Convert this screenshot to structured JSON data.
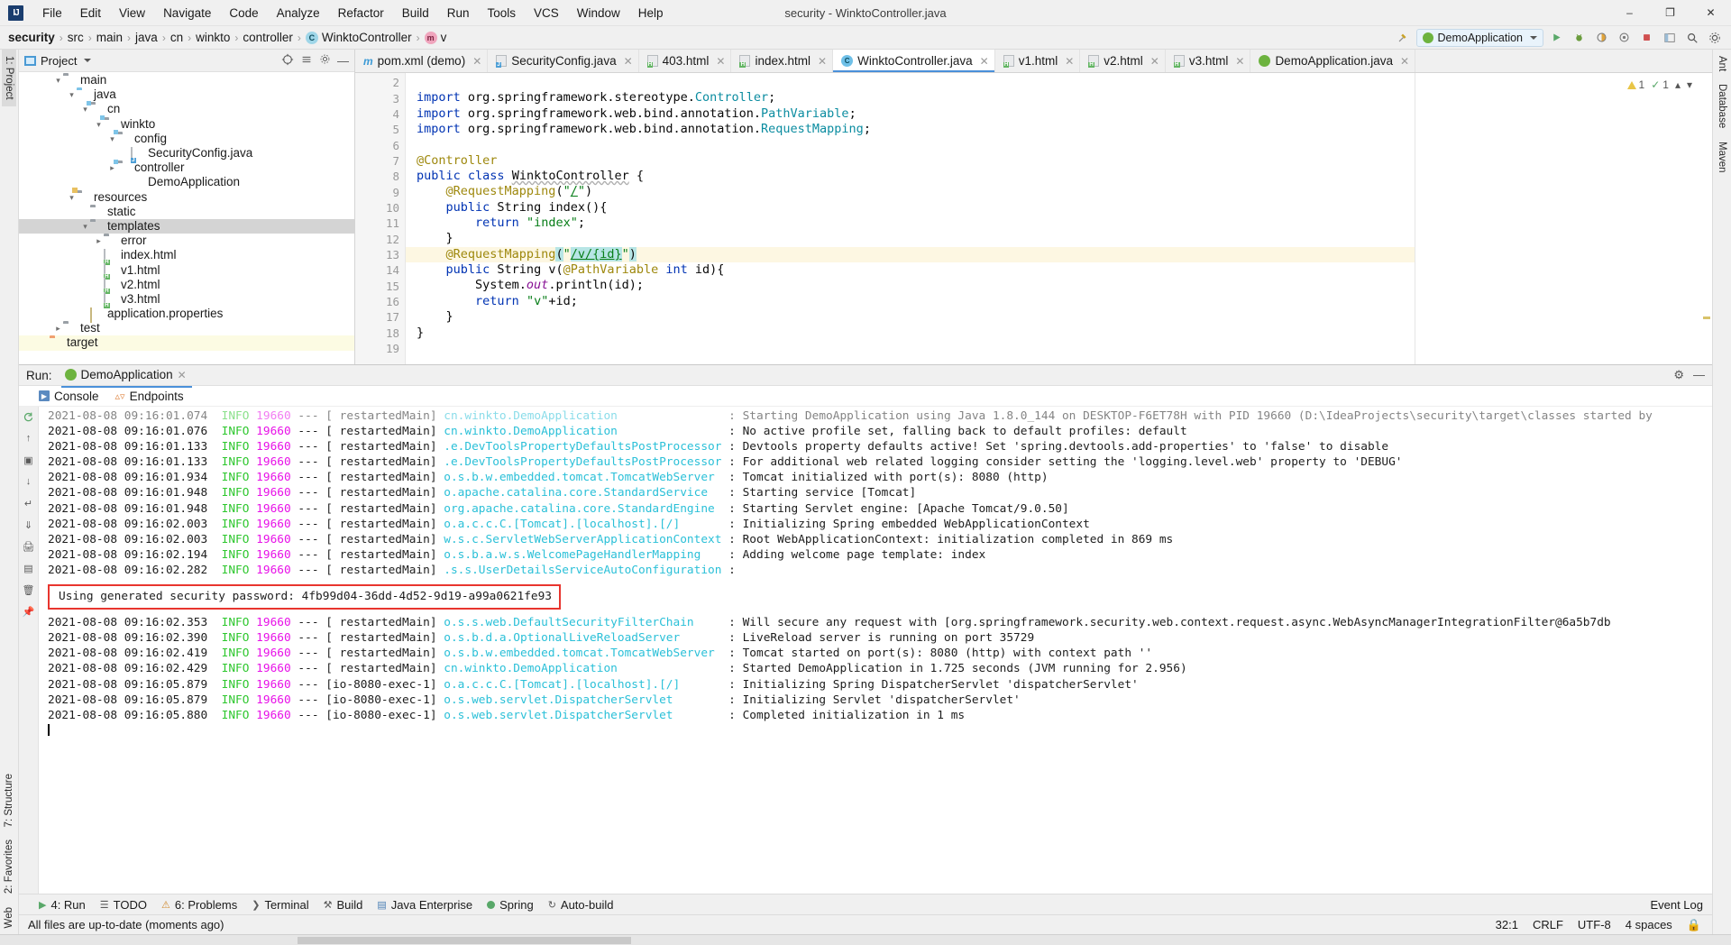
{
  "window": {
    "title": "security - WinktoController.java",
    "logo": "IJ",
    "minimize": "–",
    "maximize": "❐",
    "close": "✕"
  },
  "menu": [
    {
      "label": "File"
    },
    {
      "label": "Edit"
    },
    {
      "label": "View"
    },
    {
      "label": "Navigate"
    },
    {
      "label": "Code"
    },
    {
      "label": "Analyze"
    },
    {
      "label": "Refactor"
    },
    {
      "label": "Build"
    },
    {
      "label": "Run"
    },
    {
      "label": "Tools"
    },
    {
      "label": "VCS"
    },
    {
      "label": "Window"
    },
    {
      "label": "Help"
    }
  ],
  "breadcrumb": {
    "items": [
      {
        "label": "security",
        "icon": "",
        "bold": true
      },
      {
        "label": "src",
        "icon": ""
      },
      {
        "label": "main",
        "icon": ""
      },
      {
        "label": "java",
        "icon": ""
      },
      {
        "label": "cn",
        "icon": ""
      },
      {
        "label": "winkto",
        "icon": ""
      },
      {
        "label": "controller",
        "icon": ""
      },
      {
        "label": "WinktoController",
        "icon": "class-icon"
      },
      {
        "label": "v",
        "icon": "method-icon"
      }
    ],
    "separator": "›"
  },
  "toolbar": {
    "run_config": "DemoApplication",
    "run_config_caret": "▾",
    "build_icon": "⚒",
    "run_icon": "▶",
    "debug_icon": "ὁE",
    "coverage_icon": "◑",
    "stop_icon": "■",
    "search_icon": "⌕",
    "layout_icon": "▣",
    "settings_icon": "⚙"
  },
  "project_pane": {
    "title": "Project",
    "caret": "▾",
    "actions": [
      "target-icon",
      "collapse-icon",
      "settings-icon",
      "hide-icon"
    ],
    "tree": [
      {
        "label": "main",
        "depth": 2,
        "arrow": "open",
        "icon": "folder-gray",
        "sel": false
      },
      {
        "label": "java",
        "depth": 3,
        "arrow": "open",
        "icon": "folder-blue",
        "sel": false
      },
      {
        "label": "cn",
        "depth": 4,
        "arrow": "open",
        "icon": "folder-src",
        "sel": false
      },
      {
        "label": "winkto",
        "depth": 5,
        "arrow": "open",
        "icon": "folder-src",
        "sel": false
      },
      {
        "label": "config",
        "depth": 6,
        "arrow": "open",
        "icon": "folder-src",
        "sel": false
      },
      {
        "label": "SecurityConfig.java",
        "depth": 7,
        "arrow": "none",
        "icon": "java-file",
        "sel": false
      },
      {
        "label": "controller",
        "depth": 6,
        "arrow": "closed",
        "icon": "folder-src",
        "sel": false
      },
      {
        "label": "DemoApplication",
        "depth": 7,
        "arrow": "none",
        "icon": "spring-file",
        "sel": false
      },
      {
        "label": "resources",
        "depth": 3,
        "arrow": "open",
        "icon": "folder-res",
        "sel": false
      },
      {
        "label": "static",
        "depth": 4,
        "arrow": "none",
        "icon": "folder-gray",
        "sel": false
      },
      {
        "label": "templates",
        "depth": 4,
        "arrow": "open",
        "icon": "folder-gray",
        "sel": true
      },
      {
        "label": "error",
        "depth": 5,
        "arrow": "closed",
        "icon": "folder-gray",
        "sel": false
      },
      {
        "label": "index.html",
        "depth": 5,
        "arrow": "none",
        "icon": "html-file",
        "sel": false
      },
      {
        "label": "v1.html",
        "depth": 5,
        "arrow": "none",
        "icon": "html-file",
        "sel": false
      },
      {
        "label": "v2.html",
        "depth": 5,
        "arrow": "none",
        "icon": "html-file",
        "sel": false
      },
      {
        "label": "v3.html",
        "depth": 5,
        "arrow": "none",
        "icon": "html-file",
        "sel": false
      },
      {
        "label": "application.properties",
        "depth": 4,
        "arrow": "none",
        "icon": "props-file",
        "sel": false
      },
      {
        "label": "test",
        "depth": 2,
        "arrow": "closed",
        "icon": "folder-gray",
        "sel": false
      },
      {
        "label": "target",
        "depth": 1,
        "arrow": "none",
        "icon": "folder-orange",
        "sel": false,
        "yellow": true
      }
    ]
  },
  "editor_tabs": [
    {
      "label": "pom.xml (demo)",
      "icon": "maven-file",
      "active": false
    },
    {
      "label": "SecurityConfig.java",
      "icon": "java-file",
      "active": false
    },
    {
      "label": "403.html",
      "icon": "html-file",
      "active": false
    },
    {
      "label": "index.html",
      "icon": "html-file",
      "active": false
    },
    {
      "label": "WinktoController.java",
      "icon": "class-file",
      "active": true
    },
    {
      "label": "v1.html",
      "icon": "html-file",
      "active": false
    },
    {
      "label": "v2.html",
      "icon": "html-file",
      "active": false
    },
    {
      "label": "v3.html",
      "icon": "html-file",
      "active": false
    },
    {
      "label": "DemoApplication.java",
      "icon": "spring-file",
      "active": false
    }
  ],
  "inspection": {
    "warnings": "1",
    "checks": "1",
    "warn_icon": "warning-triangle-icon",
    "ok_icon": "check-icon",
    "up_icon": "▴",
    "down_icon": "▾"
  },
  "code": {
    "first_line_number": 2,
    "lines": [
      {
        "n": 2,
        "text": "",
        "gutter": "",
        "fold": false
      },
      {
        "n": 3,
        "text": "import org.springframework.stereotype.Controller;",
        "gutter": "",
        "fold": true
      },
      {
        "n": 4,
        "text": "import org.springframework.web.bind.annotation.PathVariable;",
        "gutter": "",
        "fold": false
      },
      {
        "n": 5,
        "text": "import org.springframework.web.bind.annotation.RequestMapping;",
        "gutter": "",
        "fold": true
      },
      {
        "n": 6,
        "text": "",
        "gutter": "",
        "fold": false
      },
      {
        "n": 7,
        "text": "@Controller",
        "gutter": "bean",
        "fold": false
      },
      {
        "n": 8,
        "text": "public class WinktoController {",
        "gutter": "run",
        "fold": false
      },
      {
        "n": 9,
        "text": "    @RequestMapping(\"/\")",
        "gutter": "",
        "fold": false
      },
      {
        "n": 10,
        "text": "    public String index(){",
        "gutter": "run",
        "fold": true
      },
      {
        "n": 11,
        "text": "        return \"index\";",
        "gutter": "",
        "fold": false
      },
      {
        "n": 12,
        "text": "    }",
        "gutter": "",
        "fold": true
      },
      {
        "n": 13,
        "text": "    @RequestMapping(\"/v/{id}\")",
        "gutter": "",
        "fold": false,
        "highlight": true
      },
      {
        "n": 14,
        "text": "    public String v(@PathVariable int id){",
        "gutter": "run",
        "fold": true
      },
      {
        "n": 15,
        "text": "        System.out.println(id);",
        "gutter": "",
        "fold": false
      },
      {
        "n": 16,
        "text": "        return \"v\"+id;",
        "gutter": "",
        "fold": false
      },
      {
        "n": 17,
        "text": "    }",
        "gutter": "",
        "fold": true
      },
      {
        "n": 18,
        "text": "}",
        "gutter": "",
        "fold": false
      },
      {
        "n": 19,
        "text": "",
        "gutter": "",
        "fold": false
      }
    ]
  },
  "run_panel": {
    "label": "Run:",
    "tab": "DemoApplication",
    "tab_close": "✕",
    "settings_icon": "⚙",
    "hide_icon": "—",
    "subtabs": [
      {
        "label": "Console",
        "icon": "console-icon",
        "active": true
      },
      {
        "label": "Endpoints",
        "icon": "endpoints-icon",
        "active": false
      }
    ],
    "rail_buttons": [
      "rerun-icon",
      "up-icon",
      "camera-icon",
      "down-icon",
      "wrap-icon",
      "scroll-end-icon",
      "print-icon",
      "export-icon",
      "clear-icon",
      "pin-icon"
    ],
    "log_lines": [
      {
        "date": "2021-08-08 09:16:01.074",
        "level": "INFO",
        "pid": "19660",
        "thread": "restartedMain",
        "logger": "cn.winkto.DemoApplication",
        "msg": ": Starting DemoApplication using Java 1.8.0_144 on DESKTOP-F6ET78H with PID 19660 (D:\\IdeaProjects\\security\\target\\classes started by "
      },
      {
        "date": "2021-08-08 09:16:01.076",
        "level": "INFO",
        "pid": "19660",
        "thread": "restartedMain",
        "logger": "cn.winkto.DemoApplication",
        "msg": ": No active profile set, falling back to default profiles: default"
      },
      {
        "date": "2021-08-08 09:16:01.133",
        "level": "INFO",
        "pid": "19660",
        "thread": "restartedMain",
        "logger": ".e.DevToolsPropertyDefaultsPostProcessor",
        "msg": ": Devtools property defaults active! Set 'spring.devtools.add-properties' to 'false' to disable"
      },
      {
        "date": "2021-08-08 09:16:01.133",
        "level": "INFO",
        "pid": "19660",
        "thread": "restartedMain",
        "logger": ".e.DevToolsPropertyDefaultsPostProcessor",
        "msg": ": For additional web related logging consider setting the 'logging.level.web' property to 'DEBUG'"
      },
      {
        "date": "2021-08-08 09:16:01.934",
        "level": "INFO",
        "pid": "19660",
        "thread": "restartedMain",
        "logger": "o.s.b.w.embedded.tomcat.TomcatWebServer",
        "msg": ": Tomcat initialized with port(s): 8080 (http)"
      },
      {
        "date": "2021-08-08 09:16:01.948",
        "level": "INFO",
        "pid": "19660",
        "thread": "restartedMain",
        "logger": "o.apache.catalina.core.StandardService",
        "msg": ": Starting service [Tomcat]"
      },
      {
        "date": "2021-08-08 09:16:01.948",
        "level": "INFO",
        "pid": "19660",
        "thread": "restartedMain",
        "logger": "org.apache.catalina.core.StandardEngine",
        "msg": ": Starting Servlet engine: [Apache Tomcat/9.0.50]"
      },
      {
        "date": "2021-08-08 09:16:02.003",
        "level": "INFO",
        "pid": "19660",
        "thread": "restartedMain",
        "logger": "o.a.c.c.C.[Tomcat].[localhost].[/]",
        "msg": ": Initializing Spring embedded WebApplicationContext"
      },
      {
        "date": "2021-08-08 09:16:02.003",
        "level": "INFO",
        "pid": "19660",
        "thread": "restartedMain",
        "logger": "w.s.c.ServletWebServerApplicationContext",
        "msg": ": Root WebApplicationContext: initialization completed in 869 ms"
      },
      {
        "date": "2021-08-08 09:16:02.194",
        "level": "INFO",
        "pid": "19660",
        "thread": "restartedMain",
        "logger": "o.s.b.a.w.s.WelcomePageHandlerMapping",
        "msg": ": Adding welcome page template: index"
      },
      {
        "date": "2021-08-08 09:16:02.282",
        "level": "INFO",
        "pid": "19660",
        "thread": "restartedMain",
        "logger": ".s.s.UserDetailsServiceAutoConfiguration",
        "msg": ":"
      }
    ],
    "password_box": "Using generated security password: 4fb99d04-36dd-4d52-9d19-a99a0621fe93",
    "password_box_border": "#e8352e",
    "log_lines2": [
      {
        "date": "2021-08-08 09:16:02.353",
        "level": "INFO",
        "pid": "19660",
        "thread": "restartedMain",
        "logger": "o.s.s.web.DefaultSecurityFilterChain",
        "msg": ": Will secure any request with [org.springframework.security.web.context.request.async.WebAsyncManagerIntegrationFilter@6a5b7db"
      },
      {
        "date": "2021-08-08 09:16:02.390",
        "level": "INFO",
        "pid": "19660",
        "thread": "restartedMain",
        "logger": "o.s.b.d.a.OptionalLiveReloadServer",
        "msg": ": LiveReload server is running on port 35729"
      },
      {
        "date": "2021-08-08 09:16:02.419",
        "level": "INFO",
        "pid": "19660",
        "thread": "restartedMain",
        "logger": "o.s.b.w.embedded.tomcat.TomcatWebServer",
        "msg": ": Tomcat started on port(s): 8080 (http) with context path ''"
      },
      {
        "date": "2021-08-08 09:16:02.429",
        "level": "INFO",
        "pid": "19660",
        "thread": "restartedMain",
        "logger": "cn.winkto.DemoApplication",
        "msg": ": Started DemoApplication in 1.725 seconds (JVM running for 2.956)"
      },
      {
        "date": "2021-08-08 09:16:05.879",
        "level": "INFO",
        "pid": "19660",
        "thread": "nio-8080-exec-1",
        "logger": "o.a.c.c.C.[Tomcat].[localhost].[/]",
        "msg": ": Initializing Spring DispatcherServlet 'dispatcherServlet'"
      },
      {
        "date": "2021-08-08 09:16:05.879",
        "level": "INFO",
        "pid": "19660",
        "thread": "nio-8080-exec-1",
        "logger": "o.s.web.servlet.DispatcherServlet",
        "msg": ": Initializing Servlet 'dispatcherServlet'"
      },
      {
        "date": "2021-08-08 09:16:05.880",
        "level": "INFO",
        "pid": "19660",
        "thread": "nio-8080-exec-1",
        "logger": "o.s.web.servlet.DispatcherServlet",
        "msg": ": Completed initialization in 1 ms"
      }
    ]
  },
  "left_rail": {
    "top": [
      {
        "label": "1: Project",
        "active": true
      }
    ],
    "bottom": [
      {
        "label": "7: Structure"
      },
      {
        "label": "2: Favorites"
      },
      {
        "label": "Web"
      }
    ]
  },
  "right_rail": {
    "items": [
      {
        "label": "Ant"
      },
      {
        "label": "Database"
      },
      {
        "label": "Maven"
      }
    ]
  },
  "bottom_toolwindows": {
    "items": [
      {
        "label": "4: Run",
        "icon": "run-icon",
        "active": true
      },
      {
        "label": "TODO",
        "icon": "todo-icon",
        "active": false
      },
      {
        "label": "6: Problems",
        "icon": "problems-icon",
        "active": false
      },
      {
        "label": "Terminal",
        "icon": "terminal-icon",
        "active": false
      },
      {
        "label": "Build",
        "icon": "build-icon",
        "active": false
      },
      {
        "label": "Java Enterprise",
        "icon": "java-ee-icon",
        "active": false
      },
      {
        "label": "Spring",
        "icon": "spring-icon",
        "active": false
      },
      {
        "label": "Auto-build",
        "icon": "autobuild-icon",
        "active": false
      }
    ],
    "right": "Event Log"
  },
  "statusbar": {
    "message": "All files are up-to-date (moments ago)",
    "caret_pos": "32:1",
    "line_sep": "CRLF",
    "encoding": "UTF-8",
    "indent": "4 spaces",
    "lock_icon": "lock-icon"
  }
}
